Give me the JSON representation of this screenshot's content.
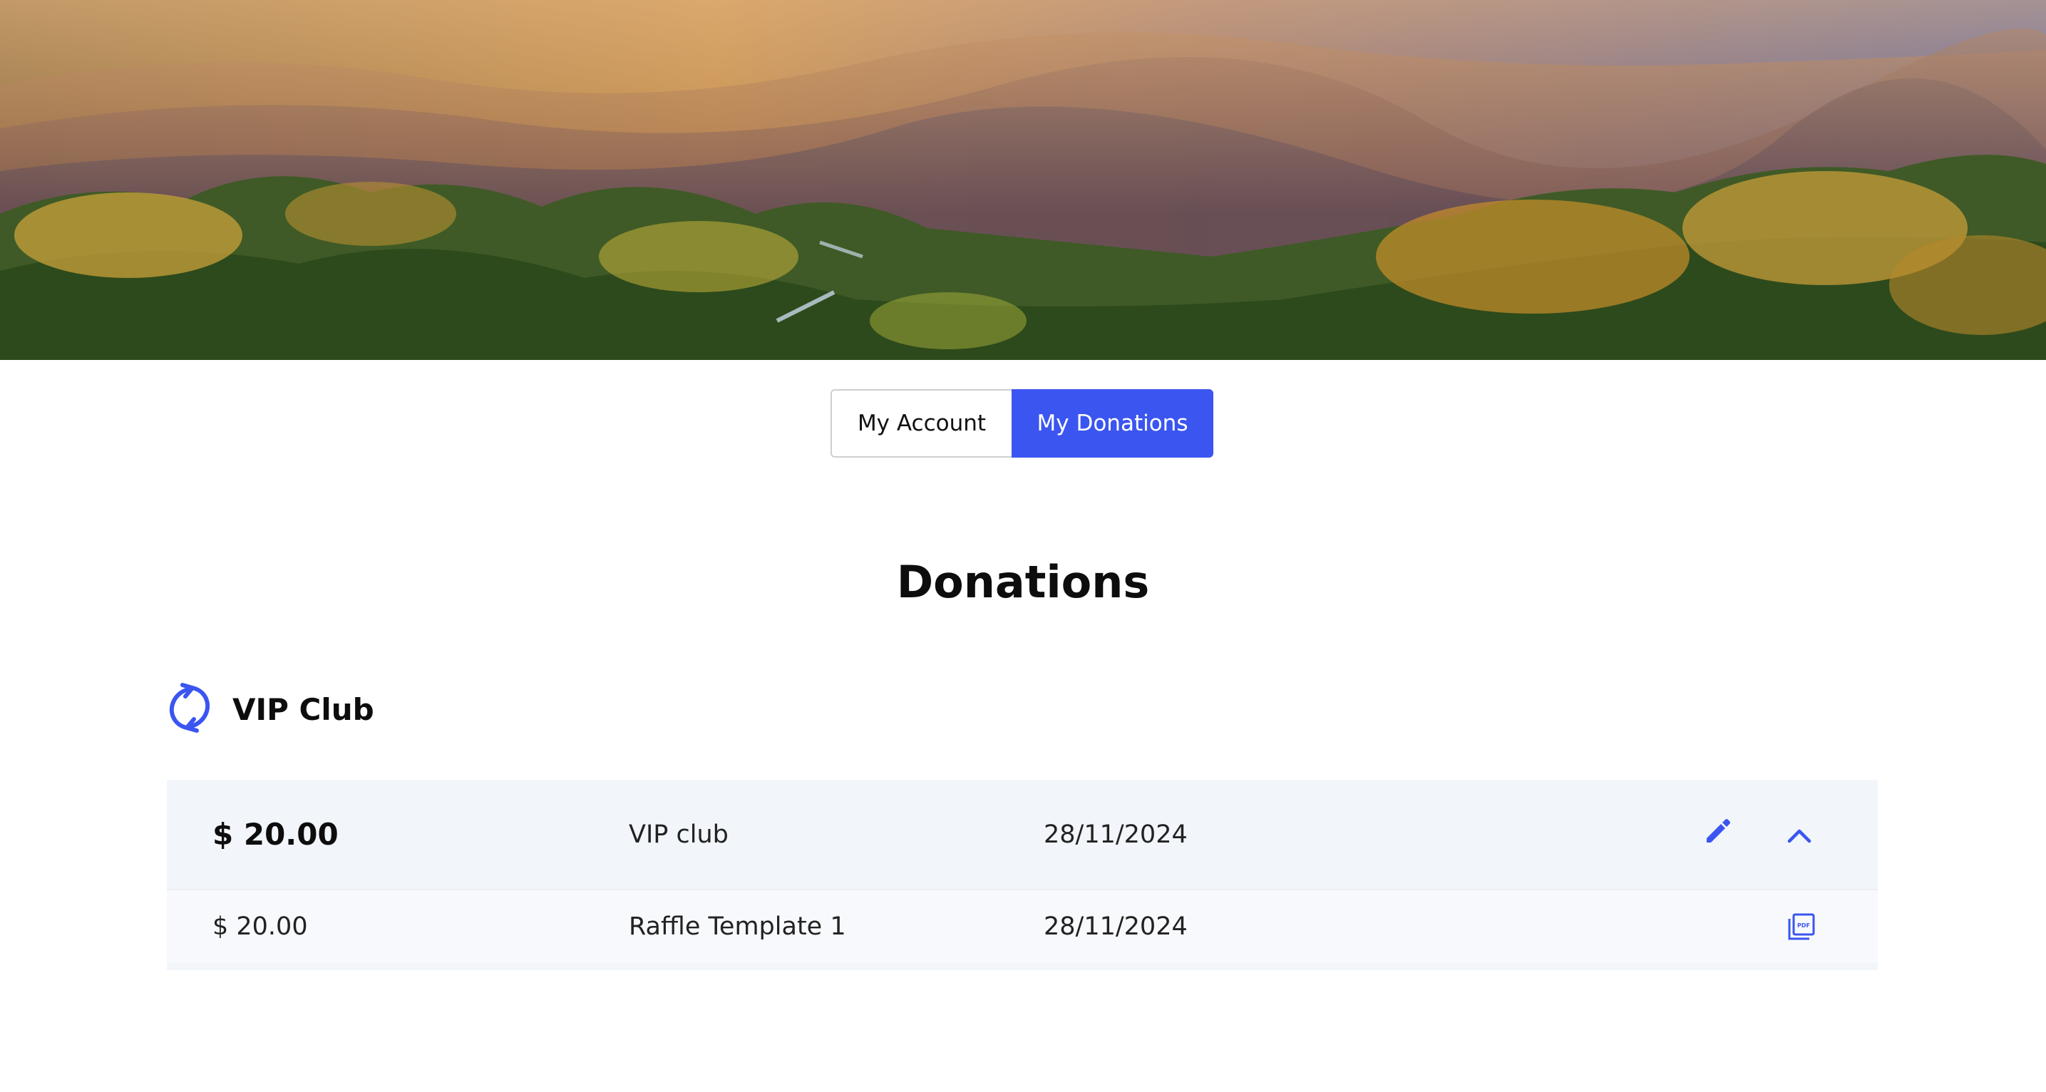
{
  "hero": {
    "alt": "Misty forested mountains at sunrise"
  },
  "tabs": [
    {
      "label": "My Account",
      "active": false
    },
    {
      "label": "My Donations",
      "active": true
    }
  ],
  "page_title": "Donations",
  "section": {
    "title": "VIP Club",
    "icon": "recurring-icon"
  },
  "donation": {
    "amount": "$ 20.00",
    "name": "VIP club",
    "date": "28/11/2024",
    "actions": [
      "edit-icon",
      "chevron-up-icon"
    ],
    "items": [
      {
        "amount": "$ 20.00",
        "name": "Raffle Template 1",
        "date": "28/11/2024",
        "action": "pdf-icon"
      }
    ]
  },
  "colors": {
    "accent": "#3b55f0",
    "row_main_bg": "#f2f5fa",
    "row_sub_bg": "#f8f9fc",
    "text": "#111111"
  }
}
